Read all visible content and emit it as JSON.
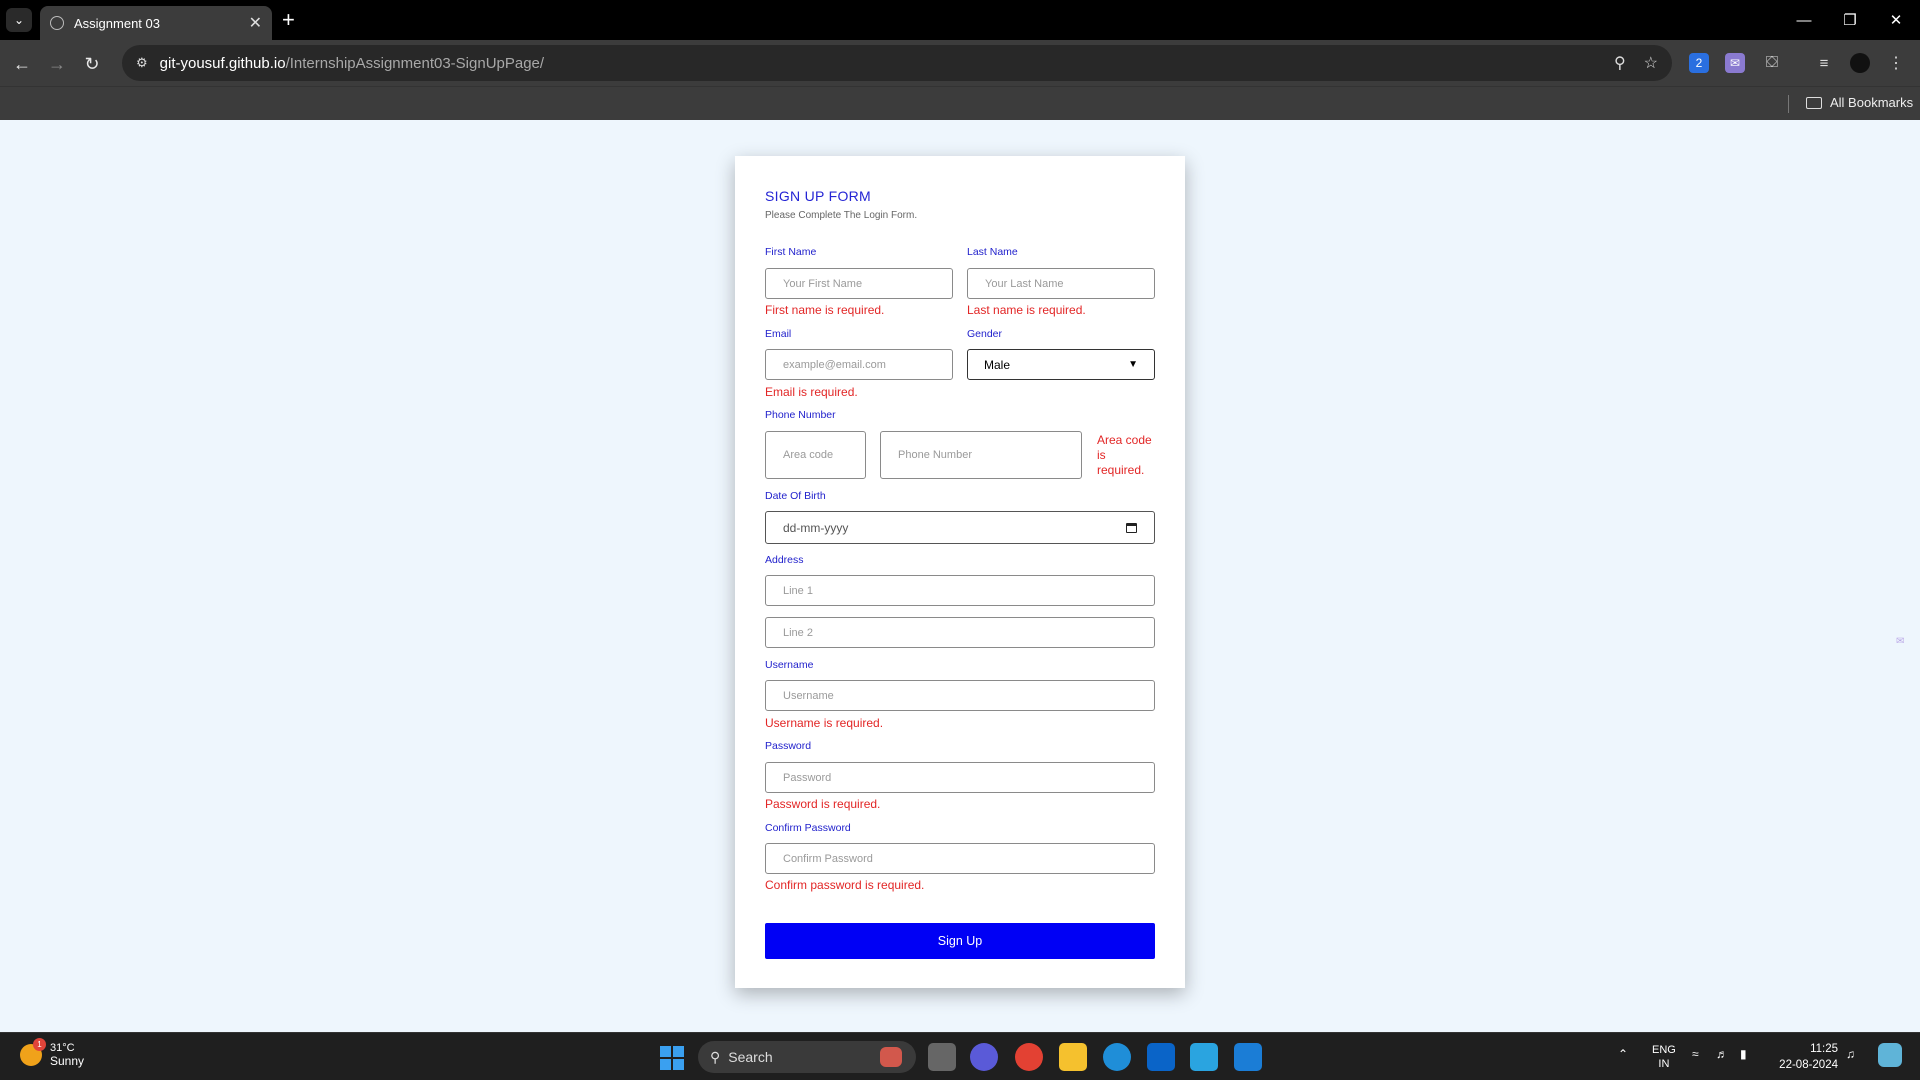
{
  "browser": {
    "tab_title": "Assignment 03",
    "url_host": "git-yousuf.github.io",
    "url_path": "/InternshipAssignment03-SignUpPage/",
    "bookmarks_label": "All Bookmarks",
    "extension_badge": "2"
  },
  "form": {
    "title": "SIGN UP FORM",
    "subtitle": "Please Complete The Login Form.",
    "first_name": {
      "label": "First Name",
      "placeholder": "Your First Name",
      "error": "First name is required."
    },
    "last_name": {
      "label": "Last Name",
      "placeholder": "Your Last Name",
      "error": "Last name is required."
    },
    "email": {
      "label": "Email",
      "placeholder": "example@email.com",
      "error": "Email is required."
    },
    "gender": {
      "label": "Gender",
      "value": "Male"
    },
    "phone": {
      "label": "Phone Number",
      "area_placeholder": "Area code",
      "number_placeholder": "Phone Number",
      "error_lines": [
        "Area code",
        "is",
        "required."
      ]
    },
    "dob": {
      "label": "Date Of Birth",
      "placeholder": "dd-mm-yyyy"
    },
    "address": {
      "label": "Address",
      "line1_placeholder": "Line 1",
      "line2_placeholder": "Line 2"
    },
    "username": {
      "label": "Username",
      "placeholder": "Username",
      "error": "Username is required."
    },
    "password": {
      "label": "Password",
      "placeholder": "Password",
      "error": "Password is required."
    },
    "confirm": {
      "label": "Confirm Password",
      "placeholder": "Confirm Password",
      "error": "Confirm password is required."
    },
    "submit_label": "Sign Up"
  },
  "taskbar": {
    "temperature": "31°C",
    "condition": "Sunny",
    "weather_badge": "1",
    "search_label": "Search",
    "lang_top": "ENG",
    "lang_bottom": "IN",
    "time": "11:25",
    "date": "22-08-2024"
  },
  "colors": {
    "accent": "#0000f5",
    "label": "#2222cc",
    "error": "#e22626",
    "page_bg": "#eef6fd"
  }
}
